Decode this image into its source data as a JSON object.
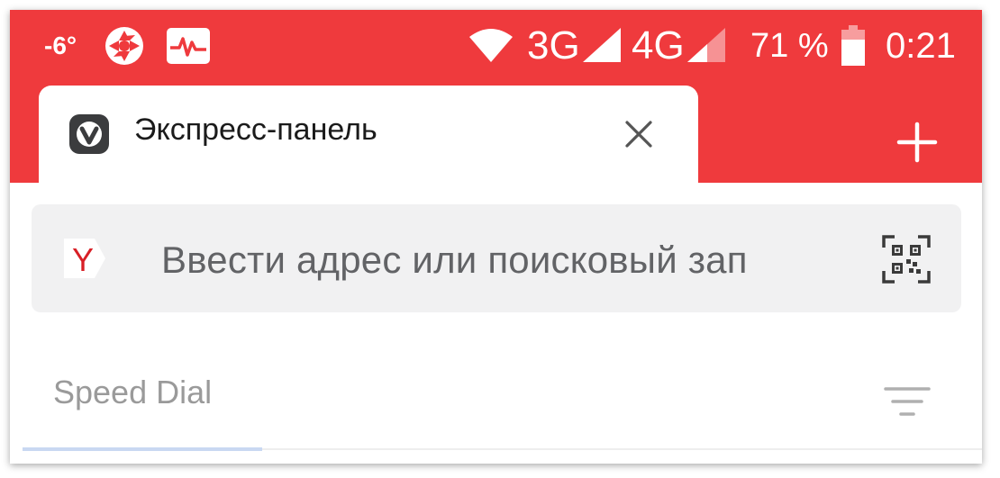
{
  "status_bar": {
    "temperature": "-6°",
    "network_3g": "3G",
    "network_4g": "4G",
    "battery_percent": "71 %",
    "battery_level": 0.71,
    "time": "0:21",
    "icons": [
      "aperture-icon",
      "pulse-monitor-icon",
      "wifi-icon",
      "signal-3g-icon",
      "signal-4g-icon",
      "battery-icon"
    ]
  },
  "tab": {
    "title": "Экспресс-панель",
    "icon": "vivaldi-logo-icon",
    "close_icon": "close-icon"
  },
  "new_tab_icon": "plus-icon",
  "address_bar": {
    "placeholder": "Ввести адрес или поисковый зап",
    "search_engine_icon": "yandex-icon",
    "search_engine_letter": "Y",
    "scan_icon": "qr-code-icon"
  },
  "speed_dial": {
    "label": "Speed Dial",
    "filter_icon": "sort-filter-icon"
  },
  "colors": {
    "accent": "#ef3a3d",
    "address_bar_bg": "#f1f1f2",
    "placeholder_text": "#626366",
    "yandex_red": "#d81f26"
  }
}
